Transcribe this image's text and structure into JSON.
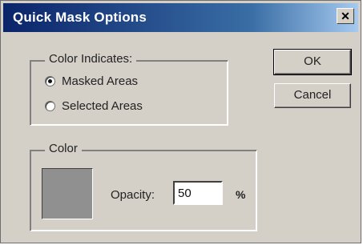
{
  "window": {
    "title": "Quick Mask Options",
    "close_glyph": "✕"
  },
  "color_indicates": {
    "legend": "Color Indicates:",
    "options": [
      {
        "label": "Masked Areas",
        "checked": true
      },
      {
        "label": "Selected Areas",
        "checked": false
      }
    ]
  },
  "buttons": {
    "ok": "OK",
    "cancel": "Cancel"
  },
  "color": {
    "legend": "Color",
    "swatch_color": "#909090",
    "opacity_label": "Opacity:",
    "opacity_value": "50",
    "percent": "%"
  }
}
